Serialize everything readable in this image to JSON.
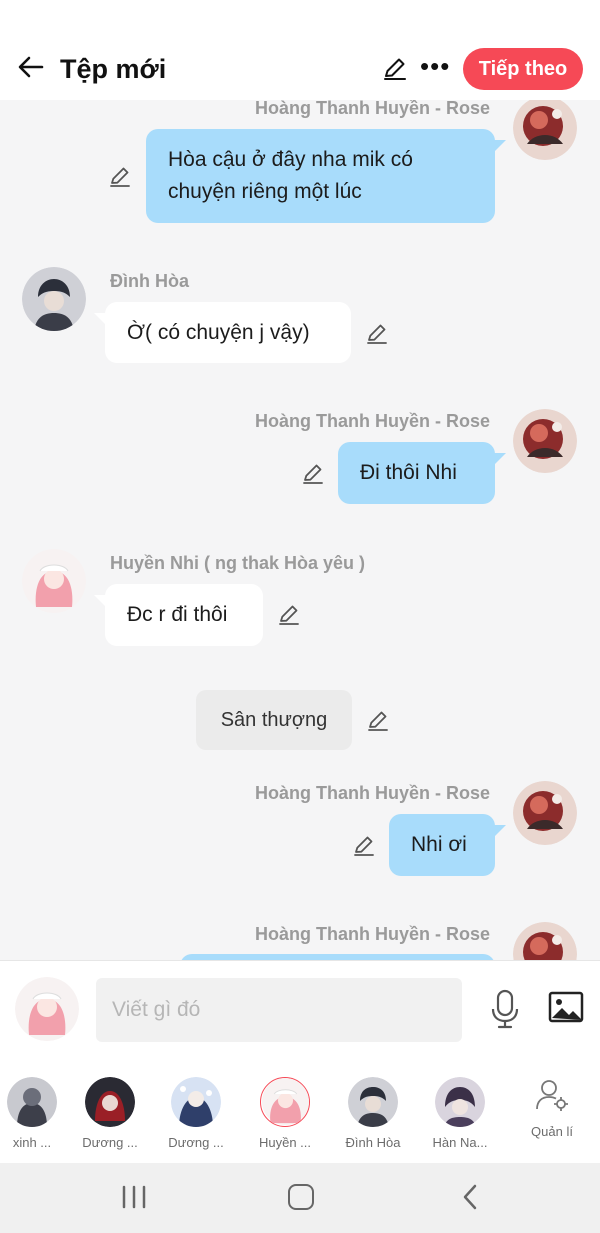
{
  "header": {
    "title": "Tệp mới",
    "next_label": "Tiếp theo",
    "more_label": "•••",
    "accent_color": "#f64956"
  },
  "messages": [
    {
      "speaker": "Hoàng Thanh Huyền - Rose",
      "side": "right",
      "text": "Hòa cậu ở đây nha mik có chuyện riêng một lúc"
    },
    {
      "speaker": "Đình Hòa",
      "side": "left",
      "text": "Ờ( có chuyện j vậy)"
    },
    {
      "speaker": "Hoàng Thanh Huyền - Rose",
      "side": "right",
      "text": "Đi thôi Nhi"
    },
    {
      "speaker": "Huyền Nhi ( ng thak Hòa yêu )",
      "side": "left",
      "text": "Đc r đi thôi"
    },
    {
      "speaker": "",
      "side": "center",
      "text": "Sân thượng"
    },
    {
      "speaker": "Hoàng Thanh Huyền - Rose",
      "side": "right",
      "text": "Nhi ơi"
    },
    {
      "speaker": "Hoàng Thanh Huyền - Rose",
      "side": "right",
      "text": ""
    }
  ],
  "composer": {
    "placeholder": "Viết gì đó",
    "mic_icon": "microphone-icon",
    "image_icon": "image-icon"
  },
  "characters": [
    {
      "label": "xinh ...",
      "color": "#4a4a55"
    },
    {
      "label": "Dương ...",
      "color": "#7a1c22"
    },
    {
      "label": "Dương ...",
      "color": "#2f3f6a"
    },
    {
      "label": "Huyền ...",
      "color": "#f29aa8"
    },
    {
      "label": "Đình Hòa",
      "color": "#5b5b66"
    },
    {
      "label": "Hàn Na...",
      "color": "#4b3f5c"
    }
  ],
  "manage_label": "Quản lí",
  "bubble_colors": {
    "mine": "#a8dcfb",
    "theirs": "#ffffff"
  }
}
